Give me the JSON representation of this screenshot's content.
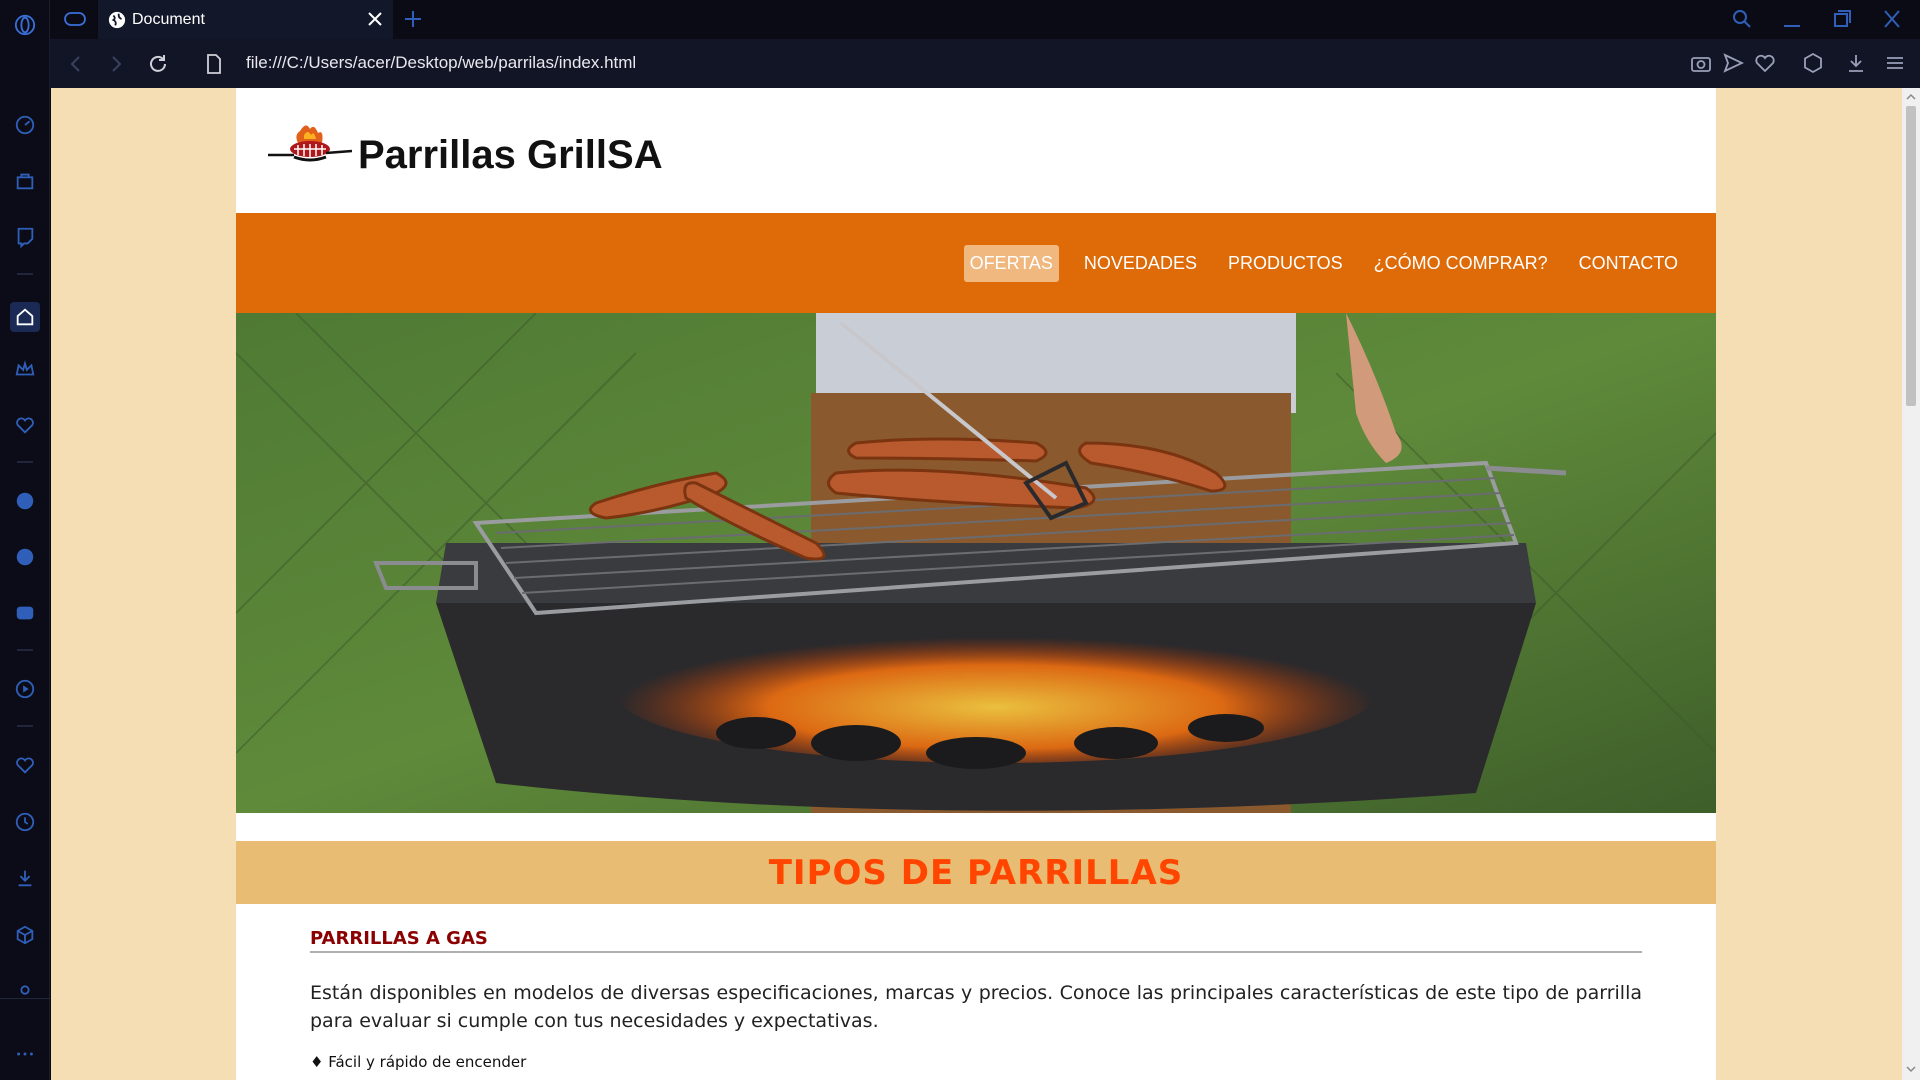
{
  "browser": {
    "tab_title": "Document",
    "url": "file:///C:/Users/acer/Desktop/web/parrilas/index.html"
  },
  "site": {
    "brand": "Parrillas GrillSA",
    "nav": [
      {
        "label": "OFERTAS",
        "active": true
      },
      {
        "label": "NOVEDADES",
        "active": false
      },
      {
        "label": "PRODUCTOS",
        "active": false
      },
      {
        "label": "¿CÓMO COMPRAR?",
        "active": false
      },
      {
        "label": "CONTACTO",
        "active": false
      }
    ],
    "section_title": "TIPOS DE PARRILLAS",
    "subsection_title": "PARRILLAS A GAS",
    "paragraph": "Están disponibles en modelos de diversas especificaciones, marcas y precios. Conoce las principales características de este tipo de parrilla para evaluar si cumple con tus necesidades y expectativas.",
    "bullet": "♦ Fácil y rápido de encender"
  },
  "colors": {
    "page_bg": "#f5deb3",
    "navbar": "#de6b07",
    "nav_active": "#f0b87f",
    "section_band": "#e8bd73",
    "section_title": "#ff4500",
    "subsection_title": "#8b0000"
  }
}
